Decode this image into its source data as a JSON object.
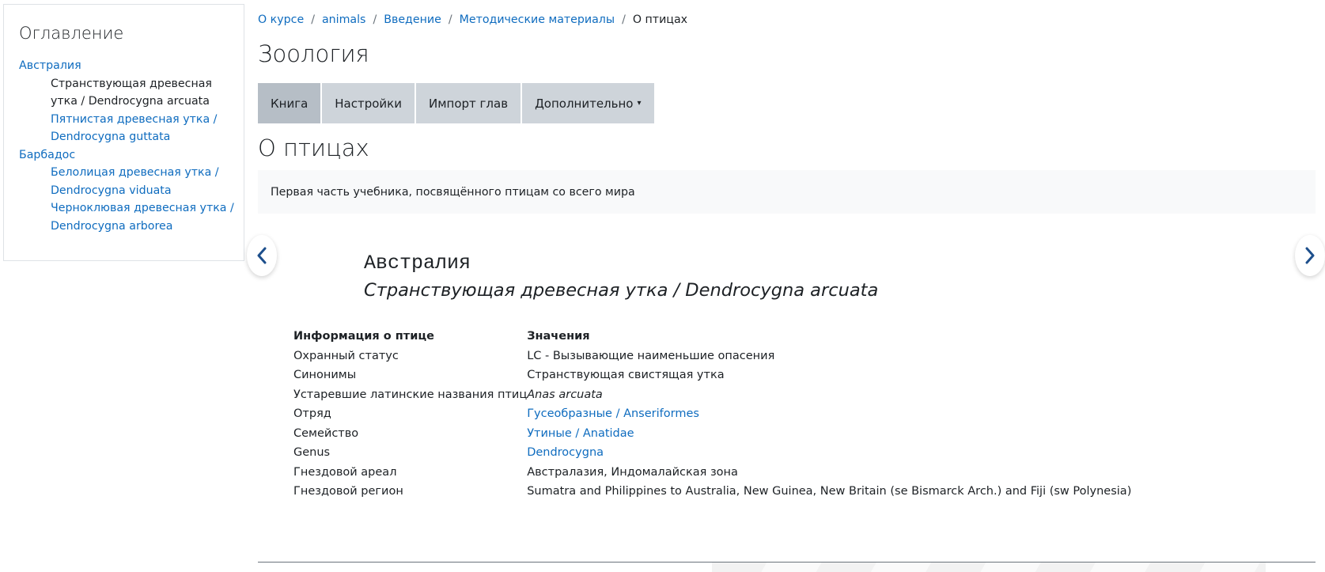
{
  "toc": {
    "title": "Оглавление",
    "chapters": [
      {
        "label": "Австралия",
        "items": [
          {
            "label": "Странствующая древесная утка / Dendrocygna arcuata",
            "current": true
          },
          {
            "label": "Пятнистая древесная утка / Dendrocygna guttata",
            "current": false
          }
        ]
      },
      {
        "label": "Барбадос",
        "items": [
          {
            "label": "Белолицая древесная утка / Dendrocygna viduata",
            "current": false
          },
          {
            "label": "Черноклювая древесная утка / Dendrocygna arborea",
            "current": false
          }
        ]
      }
    ]
  },
  "breadcrumb": [
    "О курсе",
    "animals",
    "Введение",
    "Методические материалы",
    "О птицах"
  ],
  "course_title": "Зоология",
  "tabs": [
    {
      "label": "Книга",
      "active": true
    },
    {
      "label": "Настройки",
      "active": false
    },
    {
      "label": "Импорт глав",
      "active": false
    },
    {
      "label": "Дополнительно",
      "active": false,
      "dropdown": true
    }
  ],
  "chapter_title": "О птицах",
  "intro_text": "Первая часть учебника, посвящённого птицам со всего мира",
  "section": {
    "heading": "Австралия",
    "subheading": "Странствующая древесная утка / Dendrocygna arcuata"
  },
  "info_table": {
    "headers": [
      "Информация о птице",
      "Значения"
    ],
    "rows": [
      {
        "label": "Охранный статус",
        "value": "LC - Вызывающие наименьшие опасения",
        "style": "plain"
      },
      {
        "label": "Синонимы",
        "value": "Странствующая свистящая утка",
        "style": "plain"
      },
      {
        "label": "Устаревшие латинские названия птиц",
        "value": "Anas arcuata",
        "style": "italic"
      },
      {
        "label": "Отряд",
        "value": "Гусеобразные / Anseriformes",
        "style": "link"
      },
      {
        "label": "Семейство",
        "value": "Утиные / Anatidae",
        "style": "link"
      },
      {
        "label": "Genus",
        "value": "Dendrocygna",
        "style": "link"
      },
      {
        "label": "Гнездовой ареал",
        "value": "Австралазия, Индомалайская зона",
        "style": "plain"
      },
      {
        "label": "Гнездовой регион",
        "value": "Sumatra and Philippines to Australia, New Guinea, New Britain (se Bismarck Arch.) and Fiji (sw Polynesia)",
        "style": "plain"
      }
    ]
  },
  "colors": {
    "link": "#0f6cbf",
    "tab_bg": "#ced4da",
    "tab_active_bg": "#b6bec6",
    "arrow": "#1d4f8c"
  },
  "icons": {
    "prev": "chevron-left-icon",
    "next": "chevron-right-icon",
    "dropdown": "chevron-down-icon"
  }
}
